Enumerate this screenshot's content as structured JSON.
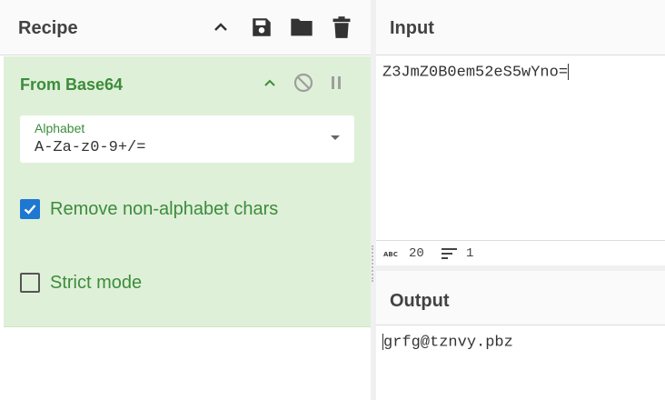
{
  "recipe": {
    "title": "Recipe",
    "icons": [
      "chevron-up-icon",
      "save-icon",
      "folder-icon",
      "trash-icon"
    ]
  },
  "operation": {
    "name": "From Base64",
    "alphabet_label": "Alphabet",
    "alphabet_value": "A-Za-z0-9+/=",
    "remove_non_alphabet_label": "Remove non-alphabet chars",
    "remove_non_alphabet_checked": true,
    "strict_mode_label": "Strict mode",
    "strict_mode_checked": false
  },
  "input": {
    "title": "Input",
    "text": "Z3JmZ0B0em52eS5wYno=",
    "stats": {
      "chars": "20",
      "lines": "1"
    }
  },
  "output": {
    "title": "Output",
    "text": "grfg@tznvy.pbz"
  },
  "colors": {
    "accent_green": "#3c8c3c",
    "op_background": "#dff0d8",
    "checkbox_blue": "#1e78d2"
  }
}
